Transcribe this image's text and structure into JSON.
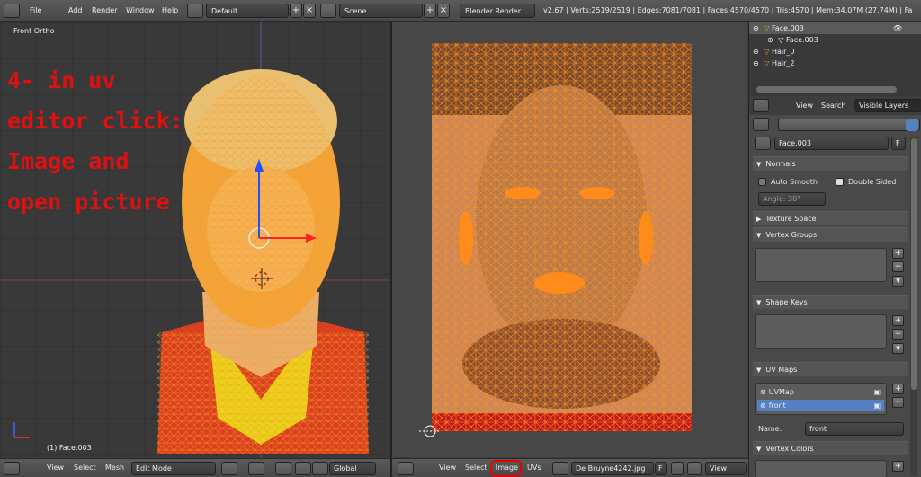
{
  "topbar": {
    "menu": [
      "File",
      "Add",
      "Render",
      "Window",
      "Help"
    ],
    "layout_name": "Default",
    "scene_name": "Scene",
    "render_engine": "Blender Render",
    "stats": "v2.67 | Verts:2519/2519 | Edges:7081/7081 | Faces:4570/4570 | Tris:4570 | Mem:34.07M (27.74M) | Fa"
  },
  "viewport3d": {
    "view_label": "Front Ortho",
    "object_label": "(1) Face.003",
    "overlay_instruction": "4- in uv\neditor click:\nImage and\nopen picture"
  },
  "header3d": {
    "menu": [
      "View",
      "Select",
      "Mesh"
    ],
    "mode": "Edit Mode",
    "orientation": "Global"
  },
  "uv_header": {
    "menu": [
      "View",
      "Select",
      "Image",
      "UVs"
    ],
    "image_name": "De Bruyne4242.jpg",
    "image_flag": "F",
    "view_label": "View"
  },
  "outliner": {
    "items": [
      "Face.003",
      "Face.003",
      "Hair_0",
      "Hair_2"
    ]
  },
  "properties": {
    "view_tabs": [
      "View",
      "Search",
      "Visible Layers"
    ],
    "mesh_name": "Face.003",
    "mesh_flag": "F",
    "normals": {
      "title": "Normals",
      "auto_smooth": "Auto Smooth",
      "double_sided": "Double Sided",
      "angle": "Angle: 30°"
    },
    "texture_space": "Texture Space",
    "vertex_groups": "Vertex Groups",
    "shape_keys": "Shape Keys",
    "uv_maps": {
      "title": "UV Maps",
      "items": [
        "UVMap",
        "front"
      ],
      "name_label": "Name:",
      "name_value": "front"
    },
    "vertex_colors": "Vertex Colors"
  },
  "colors": {
    "accent_selected": "#5680c2",
    "overlay_text": "#e01010",
    "wire": "#ff8c1a"
  }
}
